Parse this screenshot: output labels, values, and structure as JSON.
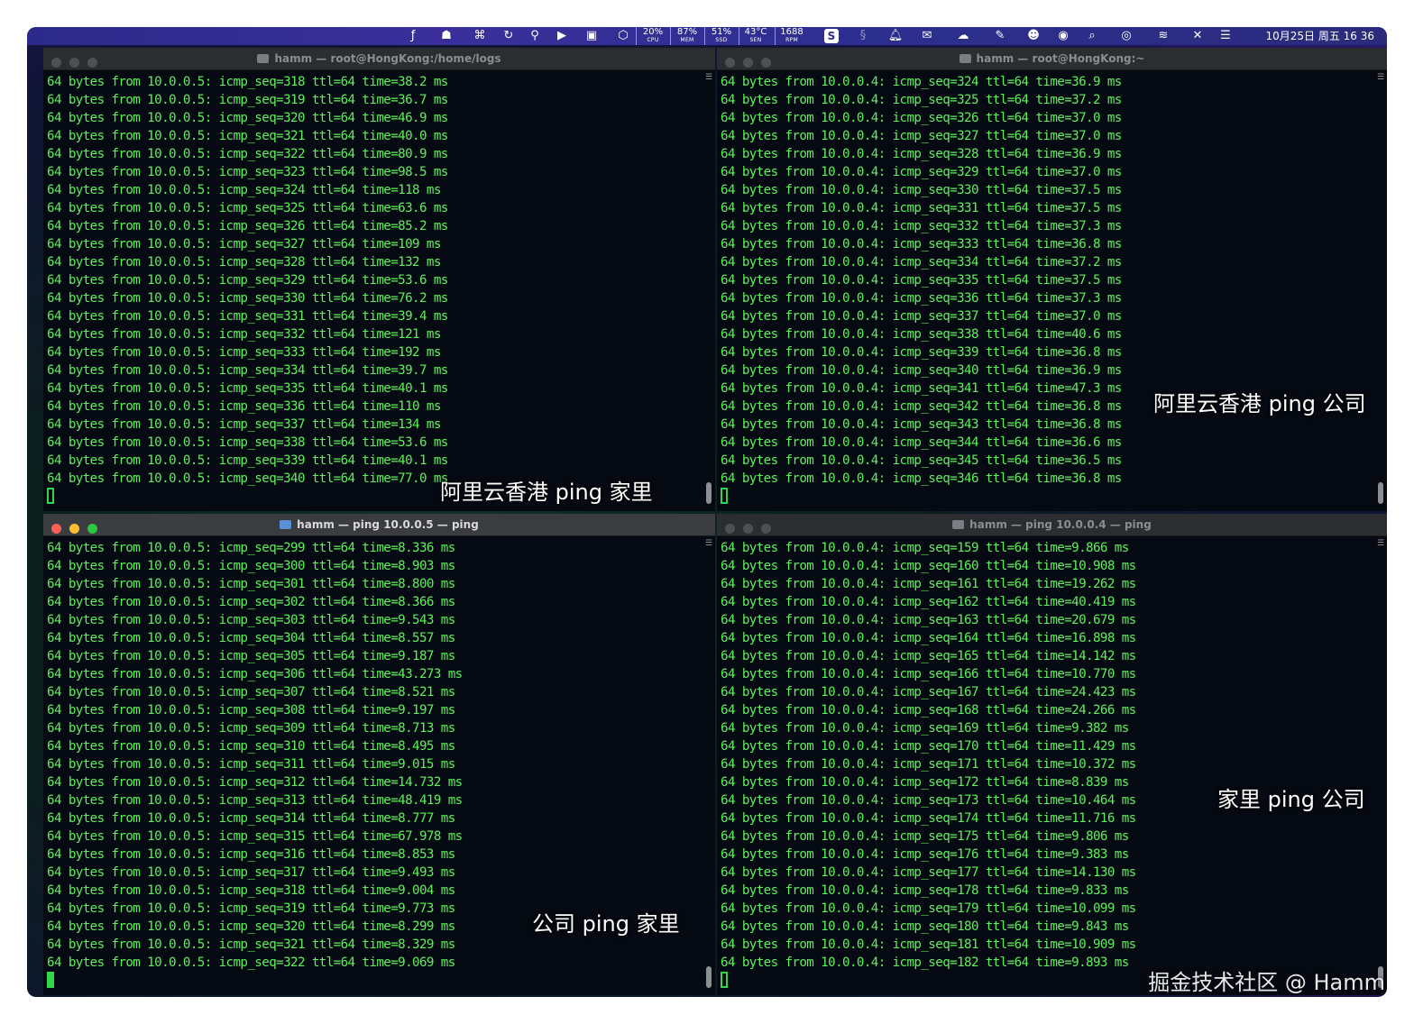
{
  "menubar": {
    "icons": [
      "font-icon",
      "hands-icon",
      "shortcut-icon",
      "sync-icon",
      "pin-icon",
      "play-icon",
      "robot-icon",
      "hexagon-icon"
    ],
    "stats": [
      {
        "value": "20%",
        "label": "CPU"
      },
      {
        "value": "87%",
        "label": "MEM"
      },
      {
        "value": "51%",
        "label": "SSD"
      },
      {
        "value": "43°C",
        "label": "SEN"
      },
      {
        "value": "1688",
        "label": "RPM"
      }
    ],
    "badge": "S",
    "clock": "10月25日 周五  16 36"
  },
  "terminals": {
    "tl": {
      "title": "hamm — root@HongKong:/home/logs",
      "lines": [
        "64 bytes from 10.0.0.5: icmp_seq=318 ttl=64 time=38.2 ms",
        "64 bytes from 10.0.0.5: icmp_seq=319 ttl=64 time=36.7 ms",
        "64 bytes from 10.0.0.5: icmp_seq=320 ttl=64 time=46.9 ms",
        "64 bytes from 10.0.0.5: icmp_seq=321 ttl=64 time=40.0 ms",
        "64 bytes from 10.0.0.5: icmp_seq=322 ttl=64 time=80.9 ms",
        "64 bytes from 10.0.0.5: icmp_seq=323 ttl=64 time=98.5 ms",
        "64 bytes from 10.0.0.5: icmp_seq=324 ttl=64 time=118 ms",
        "64 bytes from 10.0.0.5: icmp_seq=325 ttl=64 time=63.6 ms",
        "64 bytes from 10.0.0.5: icmp_seq=326 ttl=64 time=85.2 ms",
        "64 bytes from 10.0.0.5: icmp_seq=327 ttl=64 time=109 ms",
        "64 bytes from 10.0.0.5: icmp_seq=328 ttl=64 time=132 ms",
        "64 bytes from 10.0.0.5: icmp_seq=329 ttl=64 time=53.6 ms",
        "64 bytes from 10.0.0.5: icmp_seq=330 ttl=64 time=76.2 ms",
        "64 bytes from 10.0.0.5: icmp_seq=331 ttl=64 time=39.4 ms",
        "64 bytes from 10.0.0.5: icmp_seq=332 ttl=64 time=121 ms",
        "64 bytes from 10.0.0.5: icmp_seq=333 ttl=64 time=192 ms",
        "64 bytes from 10.0.0.5: icmp_seq=334 ttl=64 time=39.7 ms",
        "64 bytes from 10.0.0.5: icmp_seq=335 ttl=64 time=40.1 ms",
        "64 bytes from 10.0.0.5: icmp_seq=336 ttl=64 time=110 ms",
        "64 bytes from 10.0.0.5: icmp_seq=337 ttl=64 time=134 ms",
        "64 bytes from 10.0.0.5: icmp_seq=338 ttl=64 time=53.6 ms",
        "64 bytes from 10.0.0.5: icmp_seq=339 ttl=64 time=40.1 ms",
        "64 bytes from 10.0.0.5: icmp_seq=340 ttl=64 time=77.0 ms"
      ],
      "caption": "阿里云香港 ping 家里"
    },
    "tr": {
      "title": "hamm — root@HongKong:~",
      "lines": [
        "64 bytes from 10.0.0.4: icmp_seq=324 ttl=64 time=36.9 ms",
        "64 bytes from 10.0.0.4: icmp_seq=325 ttl=64 time=37.2 ms",
        "64 bytes from 10.0.0.4: icmp_seq=326 ttl=64 time=37.0 ms",
        "64 bytes from 10.0.0.4: icmp_seq=327 ttl=64 time=37.0 ms",
        "64 bytes from 10.0.0.4: icmp_seq=328 ttl=64 time=36.9 ms",
        "64 bytes from 10.0.0.4: icmp_seq=329 ttl=64 time=37.0 ms",
        "64 bytes from 10.0.0.4: icmp_seq=330 ttl=64 time=37.5 ms",
        "64 bytes from 10.0.0.4: icmp_seq=331 ttl=64 time=37.5 ms",
        "64 bytes from 10.0.0.4: icmp_seq=332 ttl=64 time=37.3 ms",
        "64 bytes from 10.0.0.4: icmp_seq=333 ttl=64 time=36.8 ms",
        "64 bytes from 10.0.0.4: icmp_seq=334 ttl=64 time=37.2 ms",
        "64 bytes from 10.0.0.4: icmp_seq=335 ttl=64 time=37.5 ms",
        "64 bytes from 10.0.0.4: icmp_seq=336 ttl=64 time=37.3 ms",
        "64 bytes from 10.0.0.4: icmp_seq=337 ttl=64 time=37.0 ms",
        "64 bytes from 10.0.0.4: icmp_seq=338 ttl=64 time=40.6 ms",
        "64 bytes from 10.0.0.4: icmp_seq=339 ttl=64 time=36.8 ms",
        "64 bytes from 10.0.0.4: icmp_seq=340 ttl=64 time=36.9 ms",
        "64 bytes from 10.0.0.4: icmp_seq=341 ttl=64 time=47.3 ms",
        "64 bytes from 10.0.0.4: icmp_seq=342 ttl=64 time=36.8 ms",
        "64 bytes from 10.0.0.4: icmp_seq=343 ttl=64 time=36.8 ms",
        "64 bytes from 10.0.0.4: icmp_seq=344 ttl=64 time=36.6 ms",
        "64 bytes from 10.0.0.4: icmp_seq=345 ttl=64 time=36.5 ms",
        "64 bytes from 10.0.0.4: icmp_seq=346 ttl=64 time=36.8 ms"
      ],
      "caption": "阿里云香港 ping 公司"
    },
    "bl": {
      "title": "hamm — ping 10.0.0.5 — ping",
      "lines": [
        "64 bytes from 10.0.0.5: icmp_seq=299 ttl=64 time=8.336 ms",
        "64 bytes from 10.0.0.5: icmp_seq=300 ttl=64 time=8.903 ms",
        "64 bytes from 10.0.0.5: icmp_seq=301 ttl=64 time=8.800 ms",
        "64 bytes from 10.0.0.5: icmp_seq=302 ttl=64 time=8.366 ms",
        "64 bytes from 10.0.0.5: icmp_seq=303 ttl=64 time=9.543 ms",
        "64 bytes from 10.0.0.5: icmp_seq=304 ttl=64 time=8.557 ms",
        "64 bytes from 10.0.0.5: icmp_seq=305 ttl=64 time=9.187 ms",
        "64 bytes from 10.0.0.5: icmp_seq=306 ttl=64 time=43.273 ms",
        "64 bytes from 10.0.0.5: icmp_seq=307 ttl=64 time=8.521 ms",
        "64 bytes from 10.0.0.5: icmp_seq=308 ttl=64 time=9.197 ms",
        "64 bytes from 10.0.0.5: icmp_seq=309 ttl=64 time=8.713 ms",
        "64 bytes from 10.0.0.5: icmp_seq=310 ttl=64 time=8.495 ms",
        "64 bytes from 10.0.0.5: icmp_seq=311 ttl=64 time=9.015 ms",
        "64 bytes from 10.0.0.5: icmp_seq=312 ttl=64 time=14.732 ms",
        "64 bytes from 10.0.0.5: icmp_seq=313 ttl=64 time=48.419 ms",
        "64 bytes from 10.0.0.5: icmp_seq=314 ttl=64 time=8.777 ms",
        "64 bytes from 10.0.0.5: icmp_seq=315 ttl=64 time=67.978 ms",
        "64 bytes from 10.0.0.5: icmp_seq=316 ttl=64 time=8.853 ms",
        "64 bytes from 10.0.0.5: icmp_seq=317 ttl=64 time=9.493 ms",
        "64 bytes from 10.0.0.5: icmp_seq=318 ttl=64 time=9.004 ms",
        "64 bytes from 10.0.0.5: icmp_seq=319 ttl=64 time=9.773 ms",
        "64 bytes from 10.0.0.5: icmp_seq=320 ttl=64 time=8.299 ms",
        "64 bytes from 10.0.0.5: icmp_seq=321 ttl=64 time=8.329 ms",
        "64 bytes from 10.0.0.5: icmp_seq=322 ttl=64 time=9.069 ms"
      ],
      "caption": "公司 ping 家里"
    },
    "br": {
      "title": "hamm — ping 10.0.0.4 — ping",
      "lines": [
        "64 bytes from 10.0.0.4: icmp_seq=159 ttl=64 time=9.866 ms",
        "64 bytes from 10.0.0.4: icmp_seq=160 ttl=64 time=10.908 ms",
        "64 bytes from 10.0.0.4: icmp_seq=161 ttl=64 time=19.262 ms",
        "64 bytes from 10.0.0.4: icmp_seq=162 ttl=64 time=40.419 ms",
        "64 bytes from 10.0.0.4: icmp_seq=163 ttl=64 time=20.679 ms",
        "64 bytes from 10.0.0.4: icmp_seq=164 ttl=64 time=16.898 ms",
        "64 bytes from 10.0.0.4: icmp_seq=165 ttl=64 time=14.142 ms",
        "64 bytes from 10.0.0.4: icmp_seq=166 ttl=64 time=10.770 ms",
        "64 bytes from 10.0.0.4: icmp_seq=167 ttl=64 time=24.423 ms",
        "64 bytes from 10.0.0.4: icmp_seq=168 ttl=64 time=24.266 ms",
        "64 bytes from 10.0.0.4: icmp_seq=169 ttl=64 time=9.382 ms",
        "64 bytes from 10.0.0.4: icmp_seq=170 ttl=64 time=11.429 ms",
        "64 bytes from 10.0.0.4: icmp_seq=171 ttl=64 time=10.372 ms",
        "64 bytes from 10.0.0.4: icmp_seq=172 ttl=64 time=8.839 ms",
        "64 bytes from 10.0.0.4: icmp_seq=173 ttl=64 time=10.464 ms",
        "64 bytes from 10.0.0.4: icmp_seq=174 ttl=64 time=11.716 ms",
        "64 bytes from 10.0.0.4: icmp_seq=175 ttl=64 time=9.806 ms",
        "64 bytes from 10.0.0.4: icmp_seq=176 ttl=64 time=9.383 ms",
        "64 bytes from 10.0.0.4: icmp_seq=177 ttl=64 time=14.130 ms",
        "64 bytes from 10.0.0.4: icmp_seq=178 ttl=64 time=9.833 ms",
        "64 bytes from 10.0.0.4: icmp_seq=179 ttl=64 time=10.099 ms",
        "64 bytes from 10.0.0.4: icmp_seq=180 ttl=64 time=9.843 ms",
        "64 bytes from 10.0.0.4: icmp_seq=181 ttl=64 time=10.909 ms",
        "64 bytes from 10.0.0.4: icmp_seq=182 ttl=64 time=9.893 ms"
      ],
      "caption": "家里 ping 公司"
    }
  },
  "watermark": "掘金技术社区 @ Hamm",
  "colors": {
    "terminal_text": "#5ef05a",
    "terminal_bg": "#050a12",
    "menubar": "#2b2a8a"
  }
}
